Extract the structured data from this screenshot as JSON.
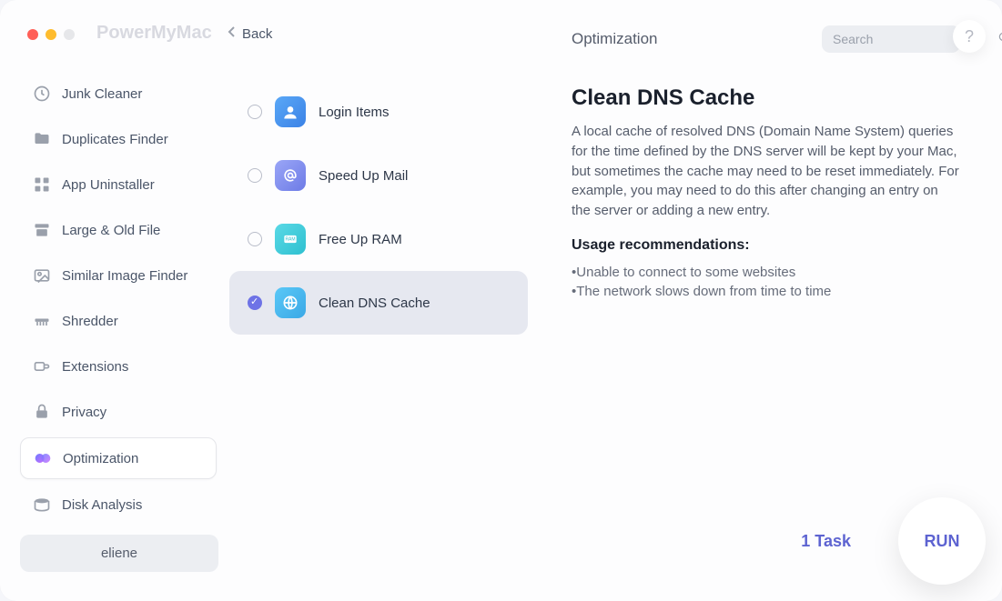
{
  "app": {
    "title": "PowerMyMac"
  },
  "traffic": {
    "red": "#ff5f57",
    "yellow": "#febc2e"
  },
  "back_label": "Back",
  "sidebar": {
    "items": [
      {
        "label": "Junk Cleaner",
        "icon": "gauge"
      },
      {
        "label": "Duplicates Finder",
        "icon": "folder"
      },
      {
        "label": "App Uninstaller",
        "icon": "grid"
      },
      {
        "label": "Large & Old File",
        "icon": "box"
      },
      {
        "label": "Similar Image Finder",
        "icon": "image"
      },
      {
        "label": "Shredder",
        "icon": "shred"
      },
      {
        "label": "Extensions",
        "icon": "ext"
      },
      {
        "label": "Privacy",
        "icon": "lock"
      },
      {
        "label": "Optimization",
        "icon": "opt",
        "active": true
      },
      {
        "label": "Disk Analysis",
        "icon": "disk"
      }
    ]
  },
  "user": {
    "name": "eliene"
  },
  "header": {
    "section": "Optimization",
    "search_placeholder": "Search"
  },
  "options": [
    {
      "label": "Login Items",
      "icon": "login",
      "selected": false
    },
    {
      "label": "Speed Up Mail",
      "icon": "mail",
      "selected": false
    },
    {
      "label": "Free Up RAM",
      "icon": "ram",
      "selected": false
    },
    {
      "label": "Clean DNS Cache",
      "icon": "dns",
      "selected": true
    }
  ],
  "detail": {
    "title": "Clean DNS Cache",
    "description": "A local cache of resolved DNS (Domain Name System) queries for the time defined by the DNS server will be kept by your Mac, but sometimes the cache may need to be reset immediately. For example, you may need to do this after changing an entry on the server or adding a new entry.",
    "usage_title": "Usage recommendations:",
    "usage_items": [
      "Unable to connect to some websites",
      "The network slows down from time to time"
    ]
  },
  "footer": {
    "task_count": "1 Task",
    "run_label": "RUN"
  },
  "help_label": "?"
}
